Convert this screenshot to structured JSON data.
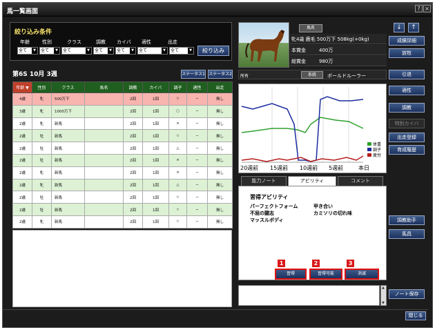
{
  "window": {
    "title": "馬一覧画面",
    "help": "?",
    "close": "×"
  },
  "filter": {
    "title": "絞り込み条件",
    "labels": [
      "年齢",
      "性別",
      "クラス",
      "調教",
      "カイバ",
      "適性",
      "出走"
    ],
    "selects": [
      "全て",
      "全て",
      "全て",
      "全て",
      "全て",
      "全て",
      "全て"
    ],
    "apply_label": "絞り込み"
  },
  "week_label": "第6S 10月 3週",
  "status_buttons": [
    "ステータス1",
    "ステータス2"
  ],
  "table": {
    "headers": [
      "年齢 ▼",
      "性別",
      "クラス",
      "馬名",
      "調教",
      "カイバ",
      "調子",
      "適性",
      "出走"
    ],
    "rows": [
      {
        "style": "pink",
        "cells": [
          "4歳",
          "牝",
          "500万下",
          "",
          "2回",
          "1回",
          "☆",
          "−",
          "無し"
        ]
      },
      {
        "style": "g",
        "cells": [
          "3歳",
          "牝",
          "1000万下",
          "",
          "2回",
          "1回",
          "○",
          "−",
          "無し"
        ]
      },
      {
        "style": "w",
        "cells": [
          "2歳",
          "牝",
          "新馬",
          "",
          "2回",
          "1回",
          "×",
          "−",
          "無し"
        ]
      },
      {
        "style": "g",
        "cells": [
          "2歳",
          "牡",
          "新馬",
          "",
          "2回",
          "1回",
          "☆",
          "−",
          "無し"
        ]
      },
      {
        "style": "w",
        "cells": [
          "2歳",
          "牡",
          "新馬",
          "",
          "2回",
          "1回",
          "△",
          "−",
          "無し"
        ]
      },
      {
        "style": "g",
        "cells": [
          "2歳",
          "牡",
          "新馬",
          "",
          "2回",
          "1回",
          "×",
          "−",
          "無し"
        ]
      },
      {
        "style": "w",
        "cells": [
          "2歳",
          "牝",
          "新馬",
          "",
          "2回",
          "1回",
          "×",
          "−",
          "無し"
        ]
      },
      {
        "style": "g",
        "cells": [
          "2歳",
          "牝",
          "新馬",
          "",
          "2回",
          "1回",
          "△",
          "−",
          "無し"
        ]
      },
      {
        "style": "w",
        "cells": [
          "2歳",
          "牡",
          "新馬",
          "",
          "2回",
          "1回",
          "☆",
          "−",
          "無し"
        ]
      },
      {
        "style": "g",
        "cells": [
          "2歳",
          "牡",
          "新馬",
          "",
          "2回",
          "1回",
          "☆",
          "−",
          "無し"
        ]
      },
      {
        "style": "w",
        "cells": [
          "2歳",
          "牝",
          "新馬",
          "",
          "2回",
          "1回",
          "☆",
          "−",
          "無し"
        ]
      }
    ]
  },
  "horse": {
    "name_button": "馬名",
    "rows": [
      {
        "label": "",
        "value": "牝4歳 鹿毛 500万下 508kg(+0kg)"
      },
      {
        "label": "本賞金",
        "value": "400万"
      },
      {
        "label": "総賞金",
        "value": "980万"
      }
    ],
    "owner_label": "所有",
    "lineage_button": "系統",
    "lineage_value": "ボールドルーラー"
  },
  "chart": {
    "x_labels": [
      "20週前",
      "15週前",
      "10週前",
      "5週前",
      "本日"
    ],
    "legend": [
      "体重",
      "調子",
      "疲労"
    ],
    "colors": {
      "weight": "#2ca02c",
      "condition": "#1a2a9e",
      "fatigue": "#b71c1c"
    }
  },
  "tabs": [
    "能力ノート",
    "アビリティ",
    "コメント"
  ],
  "ability": {
    "title": "習得アビリティ",
    "skills": [
      "パーフェクトフォーム",
      "甲き合い",
      "不屈の闘志",
      "カミソリの切れ味",
      "マッスルボディ"
    ],
    "buttons": [
      "習得",
      "習得可能",
      "消滅"
    ],
    "badges": [
      "1",
      "2",
      "3"
    ]
  },
  "side_buttons": [
    "成績詳細",
    "放牧",
    "引退",
    "適性",
    "調教",
    "特別カイバ",
    "出走登録",
    "育成履歴",
    "調教助手",
    "馬具",
    "ノート保存"
  ],
  "close_button": "閉じる",
  "arrows": [
    "↓",
    "↑"
  ]
}
